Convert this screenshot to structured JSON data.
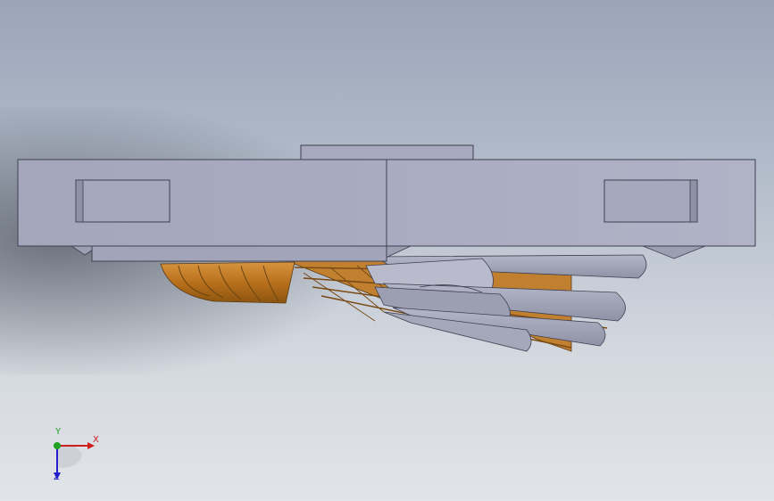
{
  "scene": {
    "background_top": "#9aa5b9",
    "background_bottom": "#e1e4e8",
    "part_color": "#a3a6bb",
    "feather_color": "#b8a870",
    "cork_color": "#c8842e"
  },
  "triad": {
    "x_label": "X",
    "y_label": "Y",
    "z_label": "Z",
    "x_color": "#cc2020",
    "y_color": "#20a020",
    "z_color": "#2020cc"
  }
}
